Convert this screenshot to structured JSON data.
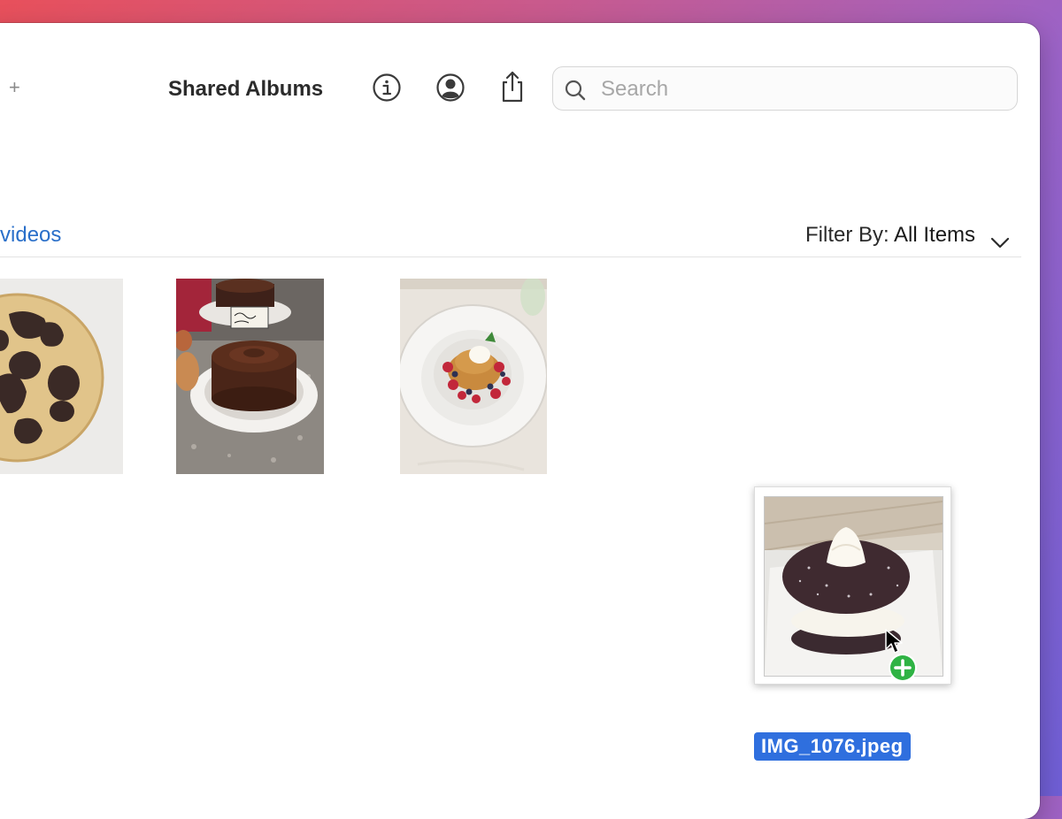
{
  "toolbar": {
    "add_symbol": "+",
    "title": "Shared Albums",
    "info_icon": "info-icon",
    "account_icon": "person-circle-icon",
    "share_icon": "share-icon"
  },
  "search": {
    "placeholder": "Search",
    "value": ""
  },
  "content": {
    "section_link": "d videos",
    "filter_prefix": "Filter By:",
    "filter_value": "All Items"
  },
  "photos": [
    {
      "name": "cookie-photo"
    },
    {
      "name": "chocolate-fudge-cake-photo"
    },
    {
      "name": "panna-cotta-photo"
    }
  ],
  "drag": {
    "filename": "IMG_1076.jpeg",
    "badge_icon": "plus-circle-icon"
  },
  "colors": {
    "link": "#2a6fc9",
    "selection": "#2f6fde",
    "badge": "#2fb344"
  }
}
